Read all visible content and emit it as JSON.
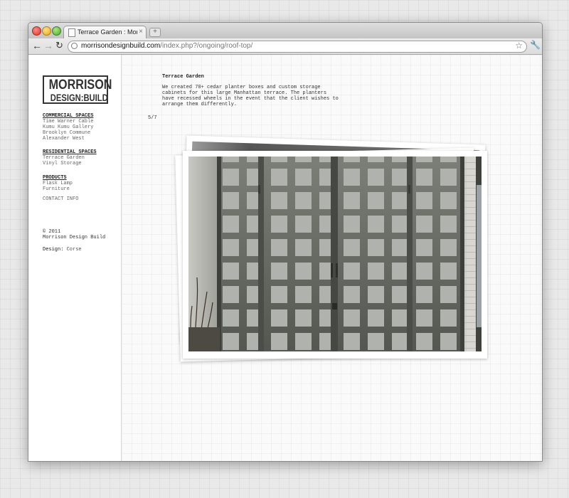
{
  "browser": {
    "tab_title": "Terrace Garden : Morrison D",
    "tab_close": "×",
    "new_tab": "+",
    "back": "←",
    "forward": "→",
    "reload": "↻",
    "url_host": "morrisondesignbuild.com",
    "url_path": "/index.php?/ongoing/roof-top/",
    "bookmark_star": "☆",
    "wrench": "🔧"
  },
  "logo": {
    "line1": "MORRISON",
    "line2": "DESIGN:BUILD"
  },
  "sidebar": {
    "sections": [
      {
        "heading": "COMMERCIAL SPACES",
        "items": [
          "Time Warner Cable",
          "Kumu Kumu Gallery",
          "Brooklyn Commune",
          "Alexander West"
        ]
      },
      {
        "heading": "RESIDENTIAL SPACES",
        "items": [
          "Terrace Garden",
          "Vinyl Storage"
        ]
      },
      {
        "heading": "PRODUCTS",
        "items": [
          "Flask Lamp",
          "Furniture"
        ]
      }
    ],
    "contact": "CONTACT INFO",
    "copyright": "© 2011",
    "company": "Morrison Design Build",
    "design_label": "Design:",
    "design_credit": "Corse"
  },
  "project": {
    "title": "Terrace Garden",
    "description": "We created 70+ cedar planter boxes and custom storage cabinets for this large Manhattan terrace. The planters have recessed wheels in the event that the client wishes to arrange them differently.",
    "counter": "5/7"
  }
}
